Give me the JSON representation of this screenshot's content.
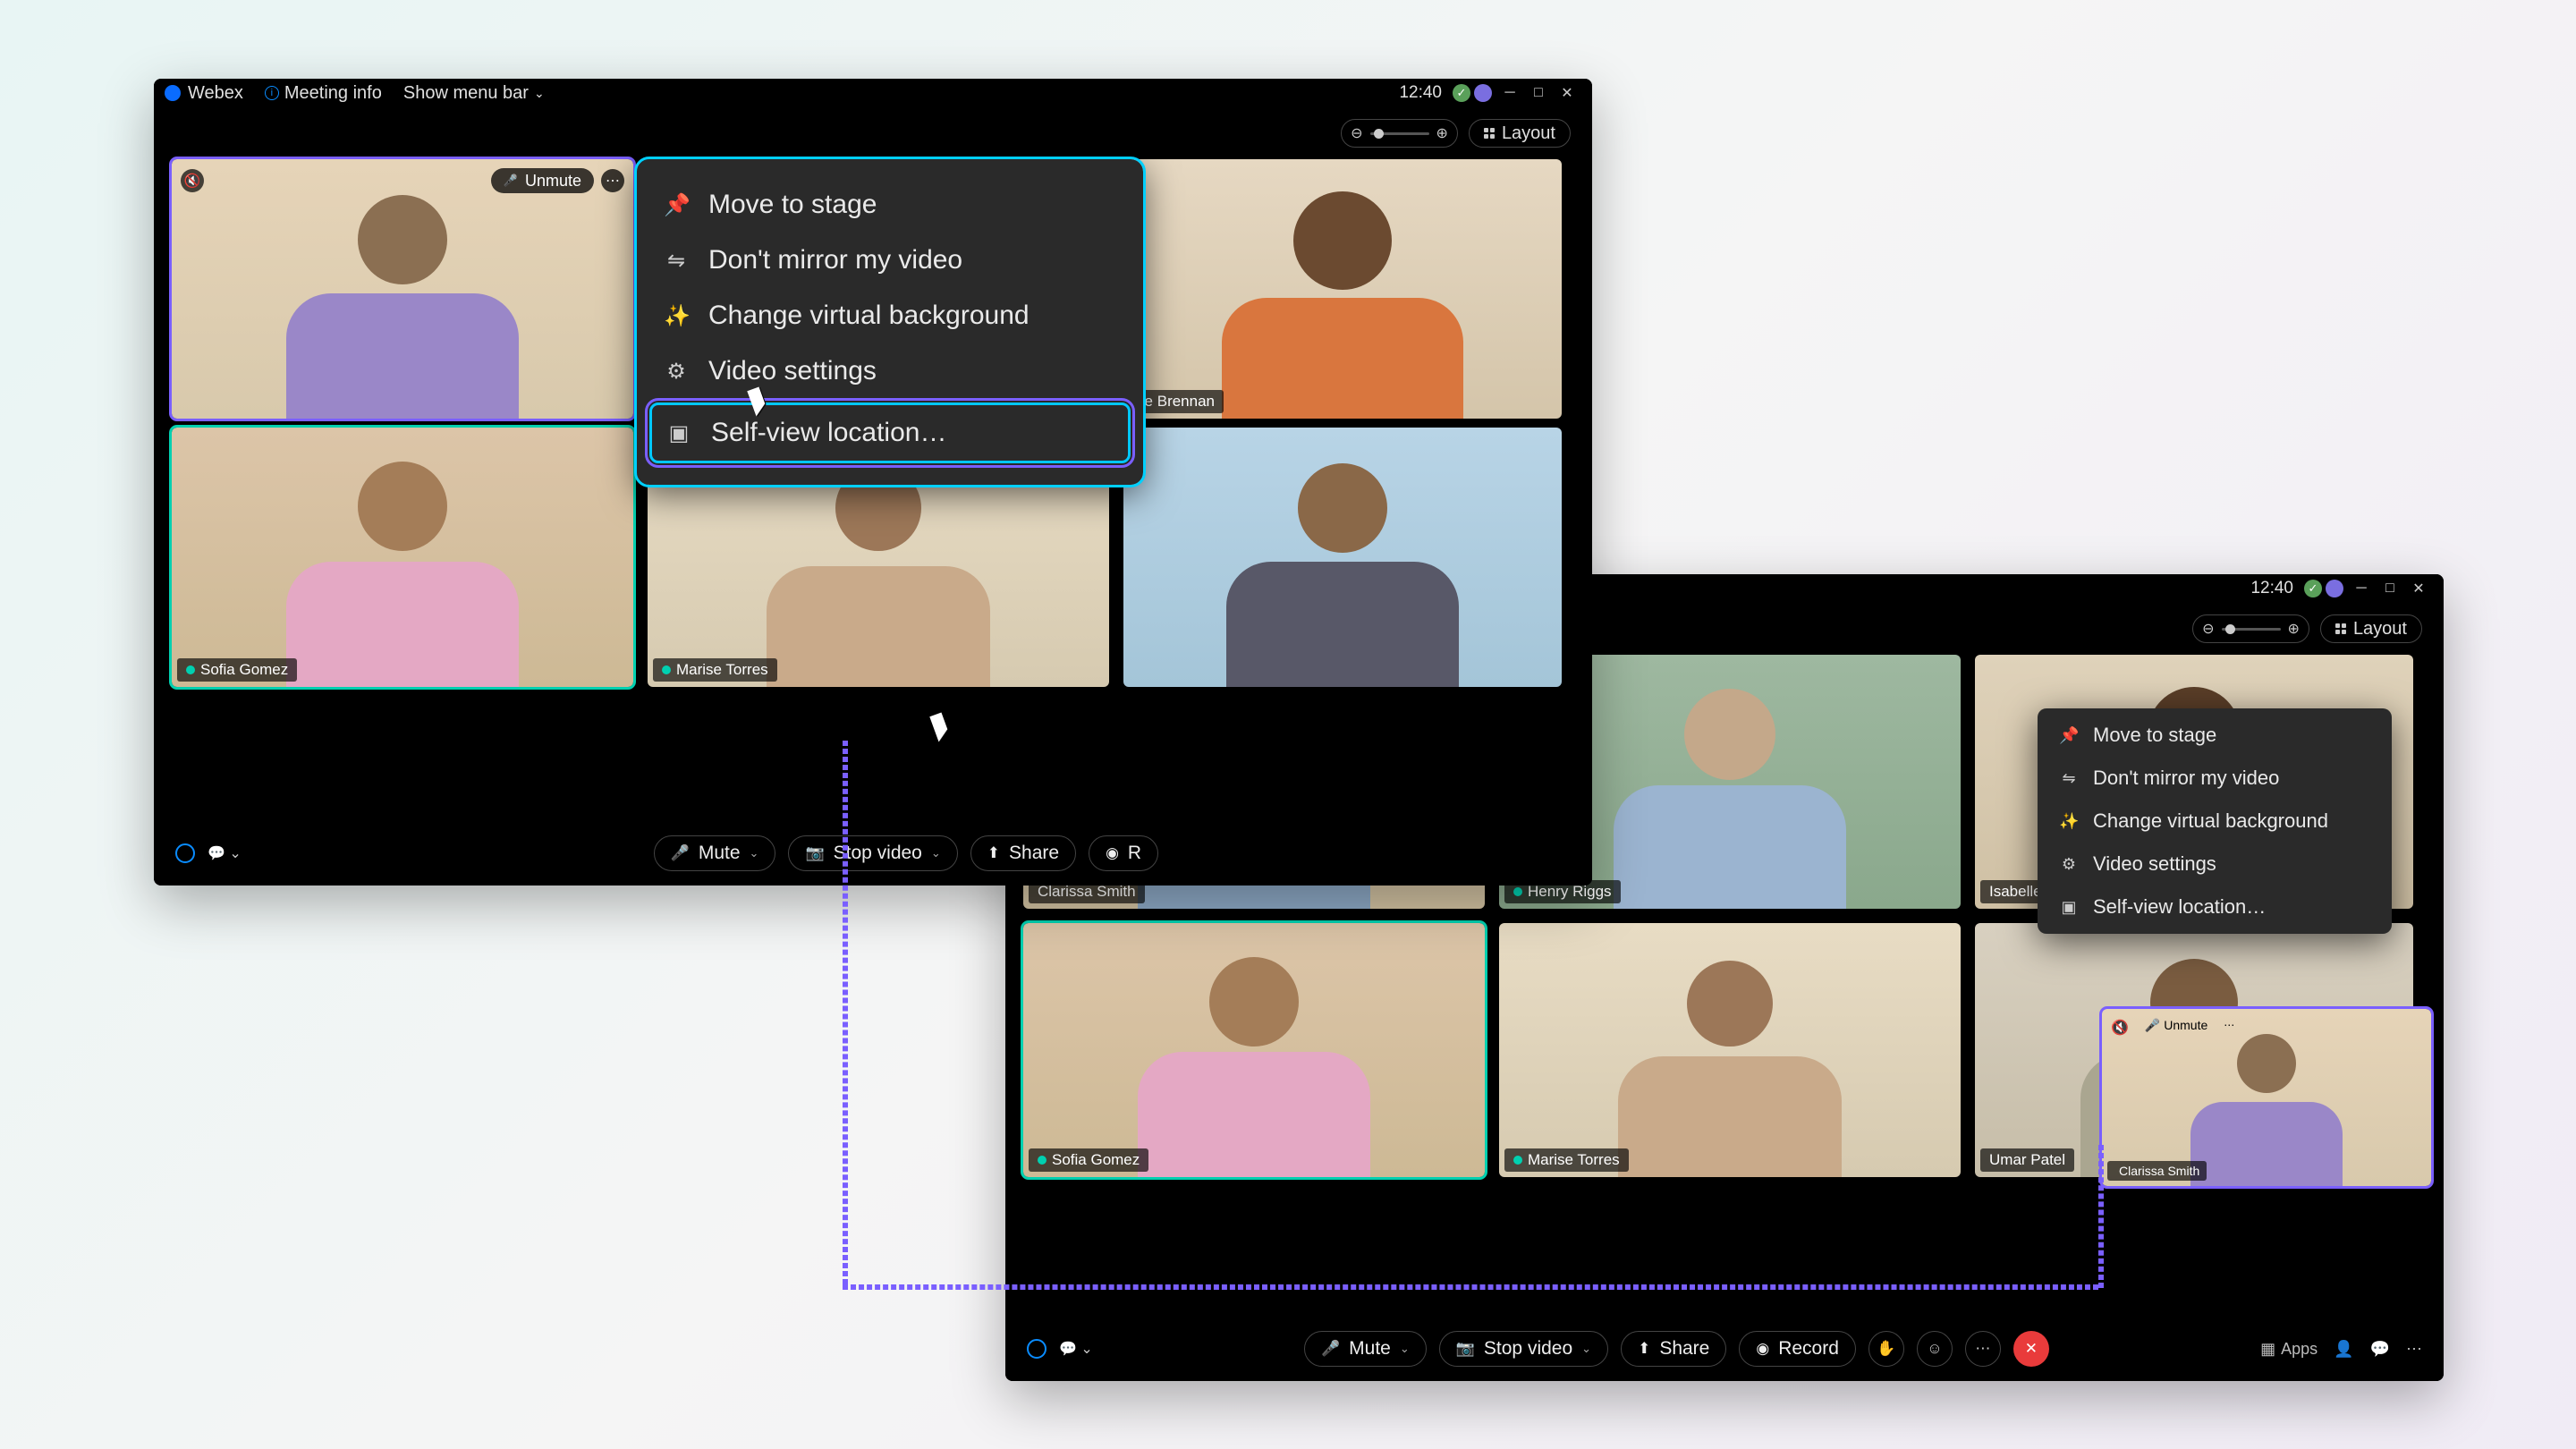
{
  "app": {
    "name": "Webex",
    "time": "12:40",
    "meeting_info": "Meeting info",
    "menu_toggle": "Show menu bar"
  },
  "toolbar": {
    "layout": "Layout"
  },
  "menu": {
    "move_stage": "Move to stage",
    "no_mirror": "Don't mirror my video",
    "virtual_bg": "Change virtual background",
    "video_settings": "Video settings",
    "self_view": "Self-view location…"
  },
  "controls": {
    "mute": "Mute",
    "unmute": "Unmute",
    "stop_video": "Stop video",
    "share": "Share",
    "record": "Record",
    "apps": "Apps"
  },
  "w1": {
    "p1": "lle Brennan",
    "p2": "Sofia Gomez",
    "p3": "Marise Torres"
  },
  "w2": {
    "p1": "Clarissa Smith",
    "p2": "Henry Riggs",
    "p3": "Isabelle Bren",
    "p4": "Sofia Gomez",
    "p5": "Marise Torres",
    "p6": "Umar Patel",
    "pip_name": "Clarissa Smith"
  },
  "r_partial": "R"
}
